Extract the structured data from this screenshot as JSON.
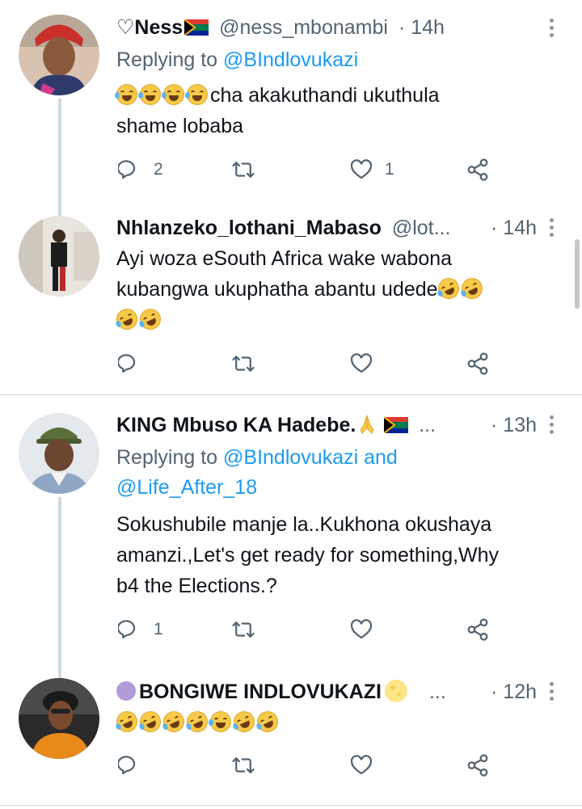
{
  "tweets": [
    {
      "name": "♡Ness",
      "name_suffix_icon": "south-africa-flag",
      "handle": "@ness_mbonambi",
      "time": "· 14h",
      "replying_prefix": "Replying to ",
      "replying_to": "@BIndlovukazi",
      "text": "cha akakuthandi ukuthula shame lobaba",
      "text_line1": "cha akakuthandi ukuthula",
      "text_line2": "shame lobaba",
      "leading_emojis": [
        "face-with-tears-of-joy",
        "face-with-tears-of-joy",
        "face-with-tears-of-joy",
        "face-with-tears-of-joy"
      ],
      "reply_count": "2",
      "retweet_count": "",
      "like_count": "1"
    },
    {
      "name": "Nhlanzeko_lothani_Mabaso",
      "handle": "@lot...",
      "time": "· 14h",
      "text_line1": "Ayi woza eSouth Africa wake wabona",
      "text_line2": "kubangwa ukuphatha abantu udede",
      "trailing_emojis": [
        "rofl",
        "rofl",
        "rofl",
        "rofl"
      ],
      "reply_count": "",
      "retweet_count": "",
      "like_count": ""
    },
    {
      "name": "KING Mbuso KA Hadebe.",
      "name_suffix_icons": [
        "folded-hands",
        "south-africa-flag"
      ],
      "handle": "...",
      "time": "· 13h",
      "replying_prefix": "Replying to ",
      "replying_to": "@BIndlovukazi",
      "replying_and": " and",
      "replying_to_2": "@Life_After_18",
      "text_line1": "Sokushubile manje la..Kukhona okushaya",
      "text_line2": "amanzi.,Let's get ready for something,Why",
      "text_line3": "b4 the Elections.?",
      "reply_count": "1",
      "retweet_count": "",
      "like_count": ""
    },
    {
      "name": "BONGIWE INDLOVUKAZI",
      "name_prefix_icon": "purple-circle",
      "name_suffix_icon": "full-moon",
      "handle": "...",
      "time": "· 12h",
      "emojis": [
        "rofl",
        "rofl",
        "rofl",
        "rofl",
        "face-with-tears-of-joy",
        "rofl",
        "rofl"
      ],
      "reply_count": "",
      "retweet_count": "",
      "like_count": ""
    }
  ],
  "colors": {
    "text": "#0f1419",
    "secondary": "#536471",
    "link": "#1d9bf0",
    "divider": "#cfd9de"
  }
}
